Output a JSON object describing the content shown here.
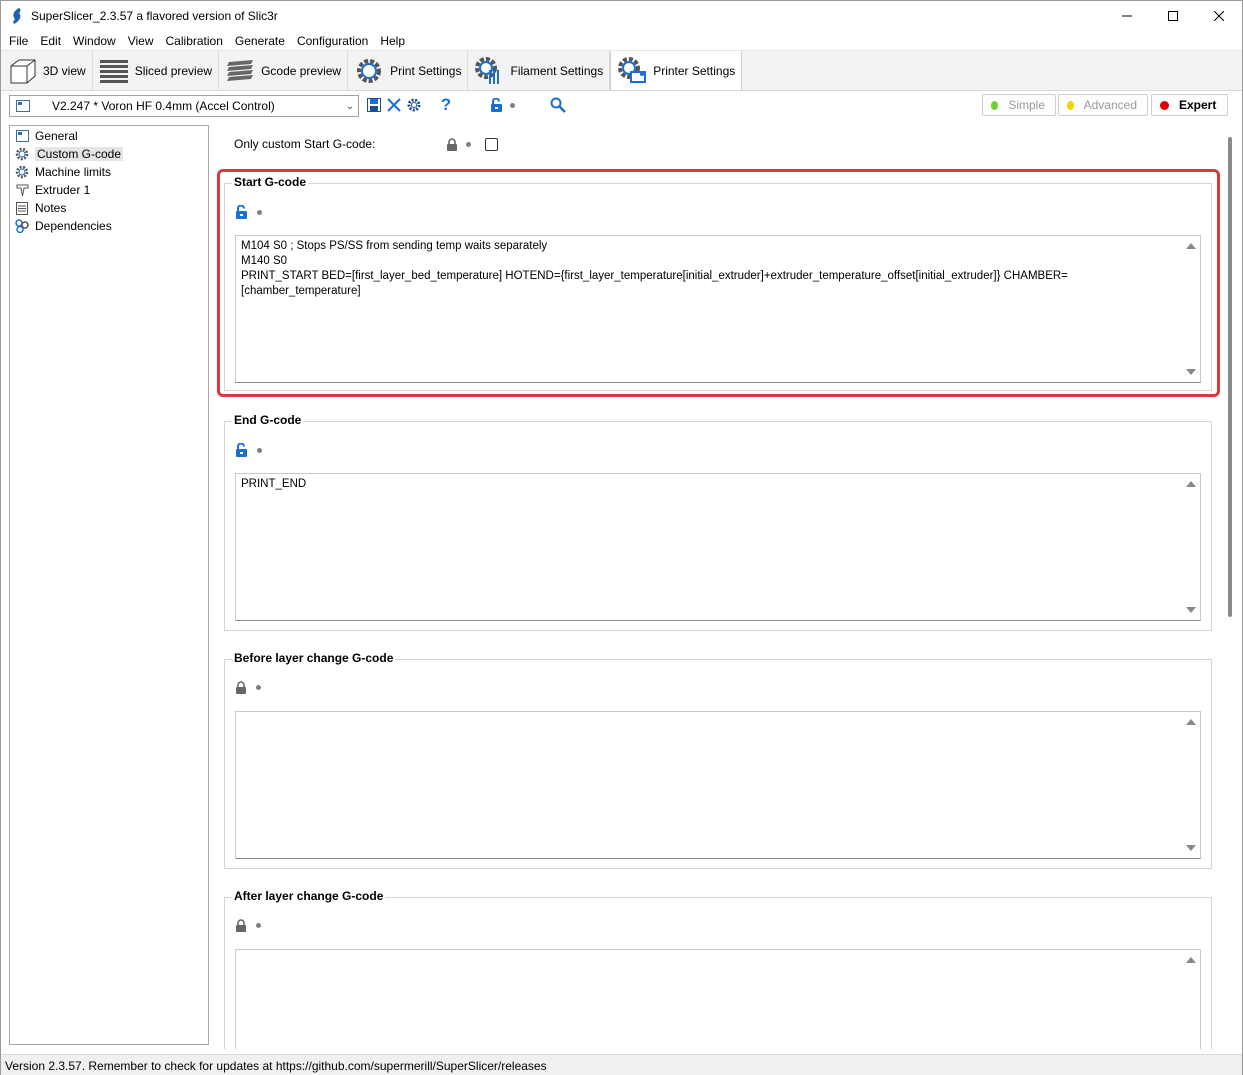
{
  "window": {
    "title": "SuperSlicer_2.3.57 a flavored version of Slic3r"
  },
  "menu": [
    "File",
    "Edit",
    "Window",
    "View",
    "Calibration",
    "Generate",
    "Configuration",
    "Help"
  ],
  "tabs": [
    {
      "label": "3D view",
      "icon": "cube-icon"
    },
    {
      "label": "Sliced preview",
      "icon": "layers-icon"
    },
    {
      "label": "Gcode preview",
      "icon": "gcode-layers-icon"
    },
    {
      "label": "Print Settings",
      "icon": "gear-icon"
    },
    {
      "label": "Filament Settings",
      "icon": "filament-gear-icon"
    },
    {
      "label": "Printer Settings",
      "icon": "printer-gear-icon",
      "active": true
    }
  ],
  "preset": {
    "name": "V2.247 * Voron HF 0.4mm (Accel Control)"
  },
  "modes": {
    "simple": "Simple",
    "advanced": "Advanced",
    "expert": "Expert",
    "simple_color": "#6dd12e",
    "advanced_color": "#f2d400",
    "expert_color": "#e00000"
  },
  "tree": [
    {
      "label": "General",
      "icon": "printer-icon"
    },
    {
      "label": "Custom G-code",
      "icon": "gear-icon",
      "selected": true
    },
    {
      "label": "Machine limits",
      "icon": "gear-icon"
    },
    {
      "label": "Extruder 1",
      "icon": "extruder-icon"
    },
    {
      "label": "Notes",
      "icon": "notes-icon"
    },
    {
      "label": "Dependencies",
      "icon": "dependencies-icon"
    }
  ],
  "content": {
    "only_custom_label": "Only custom Start G-code:",
    "groups": [
      {
        "title": "Start G-code",
        "lock": "unlocked",
        "text": "M104 S0 ; Stops PS/SS from sending temp waits separately\nM140 S0\nPRINT_START BED=[first_layer_bed_temperature] HOTEND={first_layer_temperature[initial_extruder]+extruder_temperature_offset[initial_extruder]} CHAMBER=[chamber_temperature]"
      },
      {
        "title": "End G-code",
        "lock": "unlocked",
        "text": "PRINT_END"
      },
      {
        "title": "Before layer change G-code",
        "lock": "locked",
        "text": ""
      },
      {
        "title": "After layer change G-code",
        "lock": "locked",
        "text": ""
      }
    ]
  },
  "status": {
    "text": "Version 2.3.57. Remember to check for updates at https://github.com/supermerill/SuperSlicer/releases"
  },
  "colors": {
    "highlight": "#d83b3b",
    "accent_blue": "#1a6fd6"
  }
}
